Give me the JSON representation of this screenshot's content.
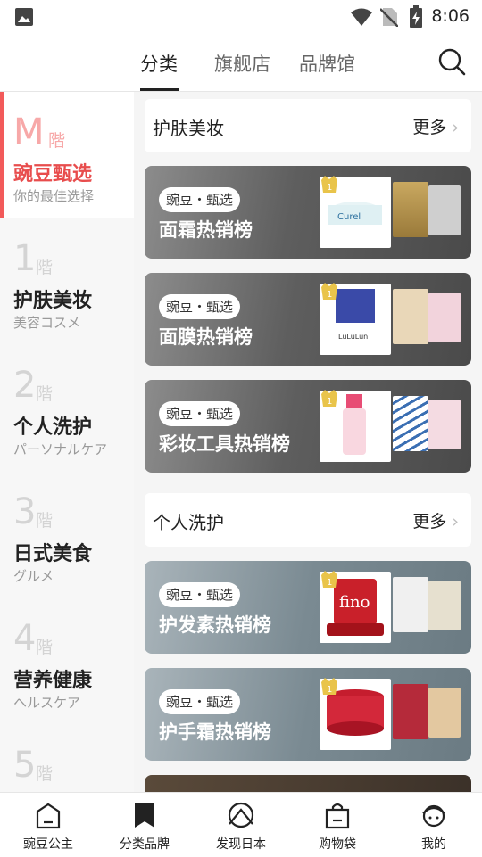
{
  "status": {
    "time": "8:06"
  },
  "topnav": {
    "tabs": [
      {
        "label": "分类"
      },
      {
        "label": "旗舰店"
      },
      {
        "label": "品牌馆"
      }
    ]
  },
  "sidebar": {
    "floors": [
      {
        "num": "M",
        "jie": "階",
        "name": "豌豆甄选",
        "sub": "你的最佳选择"
      },
      {
        "num": "1",
        "jie": "階",
        "name": "护肤美妆",
        "sub": "美容コスメ"
      },
      {
        "num": "2",
        "jie": "階",
        "name": "个人洗护",
        "sub": "パーソナルケア"
      },
      {
        "num": "3",
        "jie": "階",
        "name": "日式美食",
        "sub": "グルメ"
      },
      {
        "num": "4",
        "jie": "階",
        "name": "营养健康",
        "sub": "ヘルスケア"
      },
      {
        "num": "5",
        "jie": "階",
        "name": "",
        "sub": ""
      }
    ]
  },
  "content": {
    "sections": [
      {
        "title": "护肤美妆",
        "more": "更多"
      },
      {
        "title": "个人洗护",
        "more": "更多"
      }
    ],
    "cards": [
      {
        "tag": "豌豆・甄选",
        "title": "面霜热销榜",
        "rank": "1"
      },
      {
        "tag": "豌豆・甄选",
        "title": "面膜热销榜",
        "rank": "1"
      },
      {
        "tag": "豌豆・甄选",
        "title": "彩妆工具热销榜",
        "rank": "1"
      },
      {
        "tag": "豌豆・甄选",
        "title": "护发素热销榜",
        "rank": "1"
      },
      {
        "tag": "豌豆・甄选",
        "title": "护手霜热销榜",
        "rank": "1"
      }
    ]
  },
  "bottomnav": {
    "items": [
      {
        "label": "豌豆公主",
        "icon": "home-icon"
      },
      {
        "label": "分类品牌",
        "icon": "bookmark-icon"
      },
      {
        "label": "发现日本",
        "icon": "discover-icon"
      },
      {
        "label": "购物袋",
        "icon": "bag-icon"
      },
      {
        "label": "我的",
        "icon": "profile-icon"
      }
    ]
  }
}
